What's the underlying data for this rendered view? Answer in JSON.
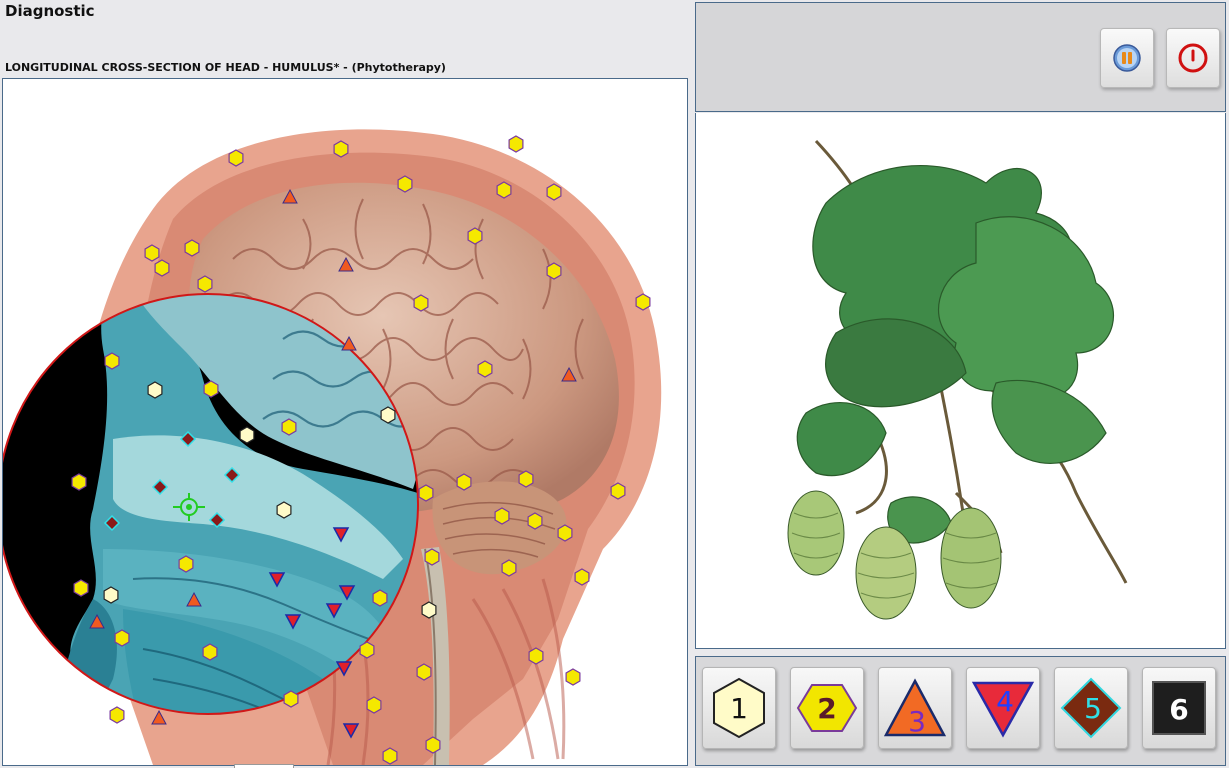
{
  "app": {
    "title": "Diagnostic"
  },
  "view": {
    "caption": "LONGITUDINAL CROSS-SECTION OF HEAD - HUMULUS* - (Phytotherapy)"
  },
  "controls": [
    {
      "name": "play-pause-button",
      "icon": "media-pause-icon"
    },
    {
      "name": "power-button",
      "icon": "power-icon"
    }
  ],
  "marker_buttons": [
    {
      "number": "1",
      "shape": "hexagon",
      "fill": "#fffbc8",
      "stroke": "#222222",
      "text_color": "#111111"
    },
    {
      "number": "2",
      "shape": "hexagon-flat",
      "fill": "#f2e600",
      "stroke": "#7a3a9a",
      "text_color": "#5a1a2a"
    },
    {
      "number": "3",
      "shape": "triangle-up",
      "fill": "#f26a24",
      "stroke": "#1a2a6a",
      "text_color": "#7a2ac0"
    },
    {
      "number": "4",
      "shape": "triangle-down",
      "fill": "#e82a3a",
      "stroke": "#2a2aa8",
      "text_color": "#2040ff"
    },
    {
      "number": "5",
      "shape": "diamond",
      "fill": "#7a2a10",
      "stroke": "#30d8e0",
      "text_color": "#30e0e8"
    },
    {
      "number": "6",
      "shape": "square",
      "fill": "#1e1e1e",
      "stroke": "#555555",
      "text_color": "#ffffff"
    }
  ],
  "colors": {
    "yellow_marker": "#f5e800",
    "pale_marker": "#fffbc8",
    "orange_marker": "#f05a20",
    "red_marker": "#e0202a",
    "diamond_marker": "#8a1a1a",
    "focus_circle": "#d01818",
    "target": "#22cc22"
  }
}
